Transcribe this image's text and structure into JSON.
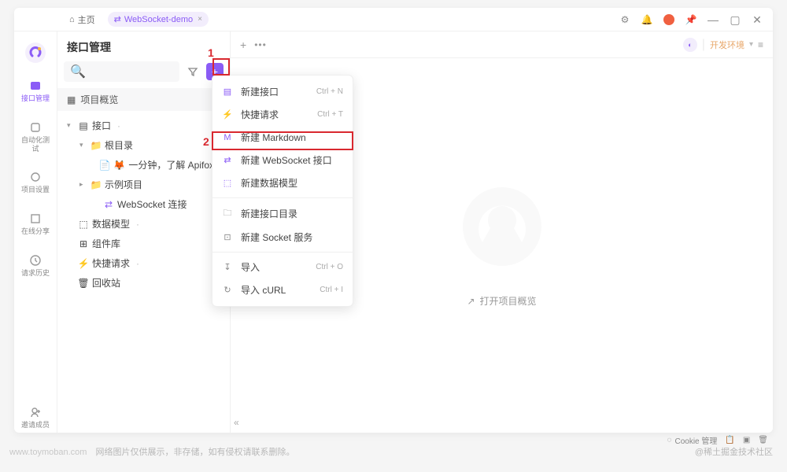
{
  "titlebar": {
    "home": "主页",
    "tab": "WebSocket-demo",
    "close_glyph": "×",
    "window_controls": {
      "minimize": "—",
      "maximize": "▢",
      "close": "✕"
    }
  },
  "nav": {
    "items": [
      {
        "label": "接口管理",
        "icon": "api-icon",
        "active": true
      },
      {
        "label": "自动化测试",
        "icon": "automation-icon"
      },
      {
        "label": "项目设置",
        "icon": "settings-icon"
      },
      {
        "label": "在线分享",
        "icon": "share-icon"
      },
      {
        "label": "请求历史",
        "icon": "history-icon"
      }
    ],
    "invite": "邀请成员"
  },
  "sidebar": {
    "title": "接口管理",
    "overview": "项目概览",
    "search_placeholder": "",
    "tree": {
      "api_root": "接口",
      "root_folder": "根目录",
      "intro_doc": "一分钟，了解 Apifox！",
      "example_project": "示例项目",
      "ws_conn": "WebSocket 连接",
      "data_model": "数据模型",
      "component": "组件库",
      "quick_req": "快捷请求",
      "recycle": "回收站"
    }
  },
  "main": {
    "env": "开发环境",
    "open_overview": "打开项目概览"
  },
  "dropdown": {
    "items": [
      {
        "icon": "api-doc-icon",
        "label": "新建接口",
        "shortcut": "Ctrl + N"
      },
      {
        "icon": "lightning-icon",
        "label": "快捷请求",
        "shortcut": "Ctrl + T"
      },
      {
        "icon": "markdown-icon",
        "label": "新建 Markdown",
        "shortcut": ""
      },
      {
        "icon": "websocket-icon",
        "label": "新建 WebSocket 接口",
        "shortcut": ""
      },
      {
        "icon": "cube-icon",
        "label": "新建数据模型",
        "shortcut": ""
      }
    ],
    "items2": [
      {
        "icon": "folder-plus-icon",
        "label": "新建接口目录"
      },
      {
        "icon": "socket-icon",
        "label": "新建 Socket 服务"
      }
    ],
    "items3": [
      {
        "icon": "import-icon",
        "label": "导入",
        "shortcut": "Ctrl + O"
      },
      {
        "icon": "curl-icon",
        "label": "导入 cURL",
        "shortcut": "Ctrl + I"
      }
    ]
  },
  "annotations": {
    "one": "1",
    "two": "2"
  },
  "bottombar": {
    "cookie": "Cookie 管理"
  },
  "footer": {
    "left_domain": "www.toymoban.com",
    "left_note": "网络图片仅供展示，非存储，如有侵权请联系删除。",
    "right": "@稀土掘金技术社区"
  }
}
